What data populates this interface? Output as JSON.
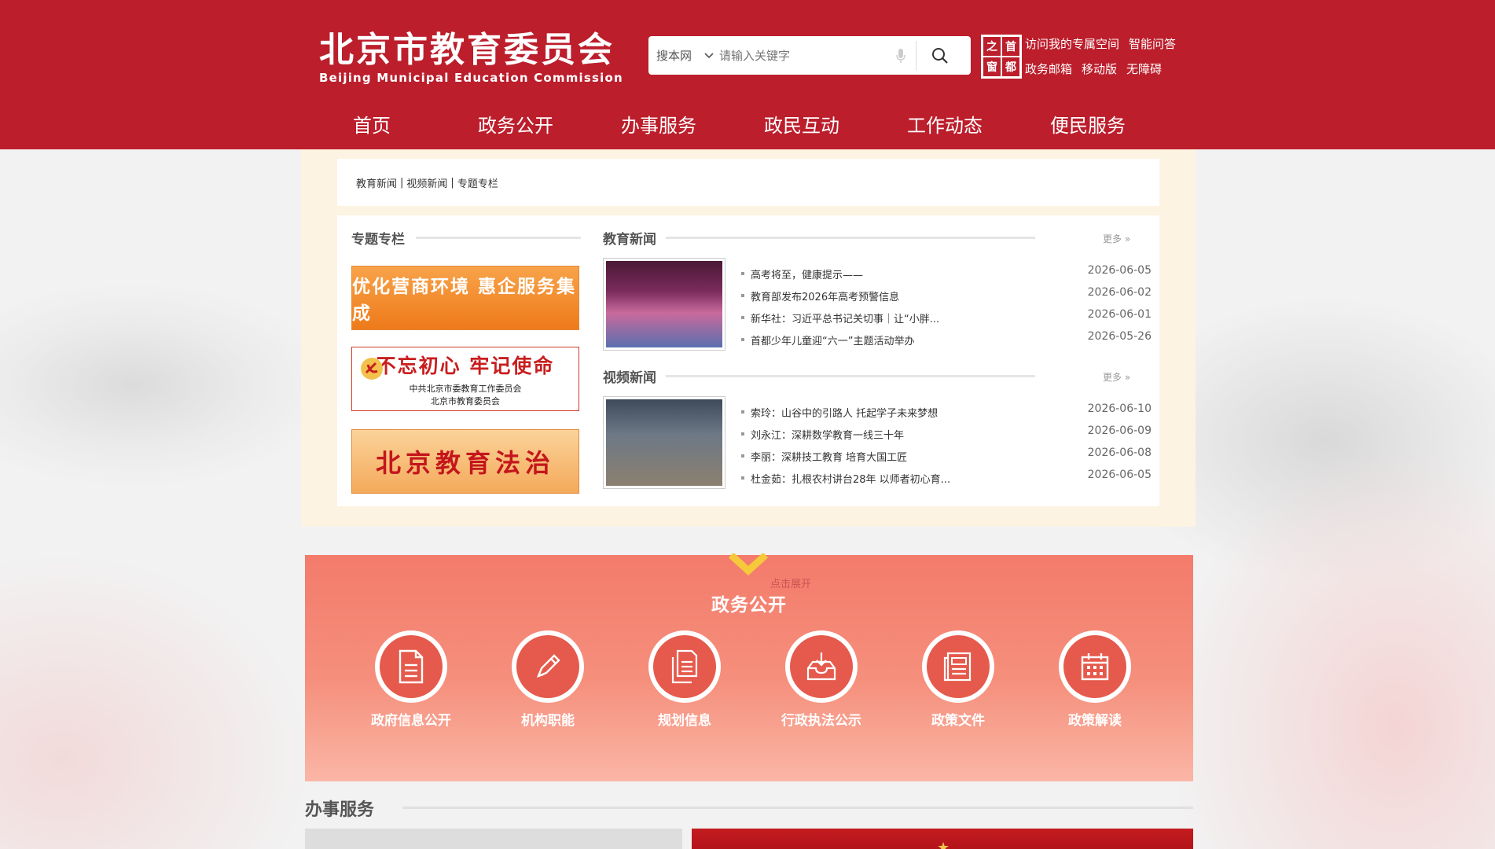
{
  "header": {
    "logo_cn": "北京市教育委员会",
    "logo_en": "Beijing Municipal Education Commission",
    "search": {
      "scope": "搜本网",
      "placeholder": "请输入关键字"
    },
    "emblem_chars": [
      "之",
      "首",
      "窗",
      "都"
    ],
    "links_row1": [
      "访问我的专属空间",
      "智能问答"
    ],
    "links_row2": [
      "政务邮箱",
      "移动版",
      "无障碍"
    ]
  },
  "nav": [
    "首页",
    "政务公开",
    "办事服务",
    "政民互动",
    "工作动态",
    "便民服务"
  ],
  "breadcrumb": [
    "教育新闻",
    "视频新闻",
    "专题专栏"
  ],
  "special": {
    "title": "专题专栏",
    "banner1": "优化营商环境 惠企服务集成",
    "banner2_line1": "不忘初心 牢记使命",
    "banner2_line2": "中共北京市委教育工作委员会",
    "banner2_line3": "北京市教育委员会",
    "banner3": "北京教育法治"
  },
  "edu_news": {
    "title": "教育新闻",
    "more": "更多",
    "items": [
      {
        "title": "高考将至，健康提示——",
        "date": "2026-06-05"
      },
      {
        "title": "教育部发布2026年高考预警信息",
        "date": "2026-06-02"
      },
      {
        "title": "新华社：习近平总书记关切事｜让“小胖...",
        "date": "2026-06-01"
      },
      {
        "title": "首都少年儿童迎“六一”主题活动举办",
        "date": "2026-05-26"
      }
    ]
  },
  "video_news": {
    "title": "视频新闻",
    "more": "更多",
    "items": [
      {
        "title": "索玲：山谷中的引路人 托起学子未来梦想",
        "date": "2026-06-10"
      },
      {
        "title": "刘永江：深耕数学教育一线三十年",
        "date": "2026-06-09"
      },
      {
        "title": "李丽：深耕技工教育 培育大国工匠",
        "date": "2026-06-08"
      },
      {
        "title": "杜金茹：扎根农村讲台28年 以师者初心育...",
        "date": "2026-06-05"
      }
    ]
  },
  "gov": {
    "expand": "点击展开",
    "title": "政务公开",
    "items": [
      {
        "label": "政府信息公开",
        "icon": "document-icon"
      },
      {
        "label": "机构职能",
        "icon": "pencil-icon"
      },
      {
        "label": "规划信息",
        "icon": "files-icon"
      },
      {
        "label": "行政执法公示",
        "icon": "inbox-icon"
      },
      {
        "label": "政策文件",
        "icon": "newspaper-icon"
      },
      {
        "label": "政策解读",
        "icon": "calendar-icon"
      }
    ]
  },
  "services": {
    "title": "办事服务"
  },
  "colors": {
    "brand_red": "#bc1e2c",
    "panel_bg": "#fdf3e2",
    "gov_bg": "#f47b6b"
  }
}
